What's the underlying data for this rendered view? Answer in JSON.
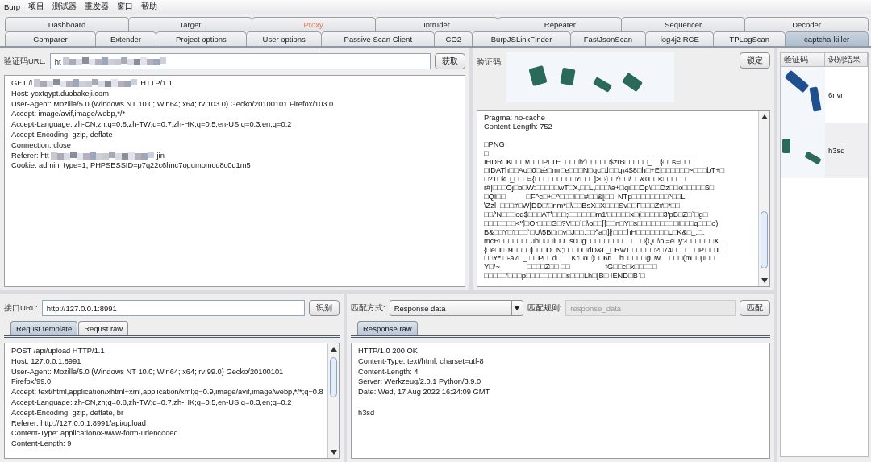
{
  "menu": [
    "Burp",
    "项目",
    "测试器",
    "重发器",
    "窗口",
    "帮助"
  ],
  "tabs_row1": [
    {
      "label": "Dashboard",
      "selected": false,
      "highlighted": false
    },
    {
      "label": "Target",
      "selected": false,
      "highlighted": false
    },
    {
      "label": "Proxy",
      "selected": false,
      "highlighted": true
    },
    {
      "label": "Intruder",
      "selected": false,
      "highlighted": false
    },
    {
      "label": "Repeater",
      "selected": false,
      "highlighted": false
    },
    {
      "label": "Sequencer",
      "selected": false,
      "highlighted": false
    },
    {
      "label": "Decoder",
      "selected": false,
      "highlighted": false
    }
  ],
  "tabs_row2": [
    {
      "label": "Comparer",
      "selected": false,
      "highlighted": false
    },
    {
      "label": "Extender",
      "selected": false,
      "highlighted": false
    },
    {
      "label": "Project options",
      "selected": false,
      "highlighted": false
    },
    {
      "label": "User options",
      "selected": false,
      "highlighted": false
    },
    {
      "label": "Passive Scan Client",
      "selected": false,
      "highlighted": false
    },
    {
      "label": "CO2",
      "selected": false,
      "highlighted": false
    },
    {
      "label": "BurpJSLinkFinder",
      "selected": false,
      "highlighted": false
    },
    {
      "label": "FastJsonScan",
      "selected": false,
      "highlighted": false
    },
    {
      "label": "log4j2 RCE",
      "selected": false,
      "highlighted": false
    },
    {
      "label": "TPLogScan",
      "selected": false,
      "highlighted": false
    },
    {
      "label": "captcha-killer",
      "selected": true,
      "highlighted": false
    }
  ],
  "captcha_request": {
    "url_label": "验证码URL:",
    "url_value": "ht",
    "fetch_button": "获取",
    "lines": [
      {
        "before": "GET /i",
        "after": "HTTP/1.1"
      },
      "Host: ycxtqypt.duobakeji.com",
      "User-Agent: Mozilla/5.0 (Windows NT 10.0; Win64; x64; rv:103.0) Gecko/20100101 Firefox/103.0",
      "Accept: image/avif,image/webp,*/*",
      "Accept-Language: zh-CN,zh;q=0.8,zh-TW;q=0.7,zh-HK;q=0.5,en-US;q=0.3,en;q=0.2",
      "Accept-Encoding: gzip, deflate",
      "Connection: close",
      {
        "before": "Referer: htt",
        "after": "jin"
      },
      "Cookie: admin_type=1; PHPSESSID=p7q22c6hnc7ogumomcu8c0q1m5"
    ]
  },
  "captcha_response": {
    "label": "验证码:",
    "lock_button": "锁定",
    "lines": [
      "Pragma: no-cache",
      "Content-Length: 752"
    ],
    "lines_after_gap": [
      "□PNG",
      "□",
      "IHDR□K□□□v□□□PLTE□□□□h^□□□□□$zrB□□□□□_□□}□□s=□□□",
      "□IDATh□□Ao□0□ǽ□mr□e□□□N□qc□⅃□□q\\4$8□h□+E|□□□□□□~□□□bT+□",
      "□?T□k□_□□□={□□□□□□□□□Y□□□]>□{□□^□□/□□&0□□<□□□□□□",
      "r#|□□□Oj□b□W:□□□□□wT□X,□□L,□□□\\a+□qi□□Op\\□□Dz□□o□□□□□6□",
      "□QI□□          □F^c□+□^□□□I□□#□□&[□□  NTp□□□□□□□□^□□L",
      "\\Zzl  □□□#□W|DD□'□nm*□\\□□BsX□X□□□Sv□□F□□□Z#□*□□",
      "□□/'N□□□oq$□□□AT\\□□□;□□□□□□m1'□□□□□x□(□□□□□3'pB□Z□`□g□",
      "□□□□□□□<\"[□Or□□□G□?V□□`□\\o□□[[□□n□Y□s□□□□□□□□□I□□□q□□□o)",
      "B&□□Y□'□□□`□U\\5B□r□v□J□□:□□^a□]∦□□□hH□□□□□□□L□K&□_:□:",
      "mcR□□□□□□□Jh□U□i□U□s0□g□□□□□□□□□□□□□{Q□\\n'=e□y?□□□□□□X□",
      "{□e□L□9□□□□]□□□D□N;□□□D□dD&L_□RwTI□□□□□?□74□□□□□□P.□□u□",
      "□□Y*.□-a7□_.□□P□□d□     Kr□o□)□□6r□□h□□□□□g□w□□□□□(m□□µ□□",
      "Y□/~             □□□□Z□□ □□                 fG□□c□k□□□□□",
      "□□□□□'□□□p□□□□□□□□□s□□□Lh□[B□ IEND□B`□"
    ]
  },
  "results": {
    "columns": [
      "验证码",
      "识别结果"
    ],
    "rows": [
      {
        "result": "6nvn",
        "selected": false
      },
      {
        "result": "h3sd",
        "selected": true
      }
    ]
  },
  "api": {
    "url_label": "接口URL:",
    "url_value": "http://127.0.0.1:8991",
    "recognize_button": "识别",
    "tabs": [
      {
        "label": "Requst template",
        "selected": true
      },
      {
        "label": "Requst raw",
        "selected": false
      }
    ],
    "lines": [
      "POST /api/upload HTTP/1.1",
      "Host: 127.0.0.1:8991",
      "User-Agent: Mozilla/5.0 (Windows NT 10.0; Win64; x64; rv:99.0) Gecko/20100101",
      "Firefox/99.0",
      "Accept: text/html,application/xhtml+xml,application/xml;q=0.9,image/avif,image/webp,*/*;q=0.8",
      "Accept-Language: zh-CN,zh;q=0.8,zh-TW;q=0.7,zh-HK;q=0.5,en-US;q=0.3,en;q=0.2",
      "Accept-Encoding: gzip, deflate, br",
      "Referer: http://127.0.0.1:8991/api/upload",
      "Content-Type: application/x-www-form-urlencoded",
      "Content-Length: 9"
    ]
  },
  "match": {
    "mode_label": "匹配方式:",
    "mode_value": "Response data",
    "rule_label": "匹配规则:",
    "rule_placeholder": "response_data",
    "match_button": "匹配",
    "tabs": [
      {
        "label": "Response raw",
        "selected": true
      }
    ],
    "lines": [
      "HTTP/1.0 200 OK",
      "Content-Type: text/html; charset=utf-8",
      "Content-Length: 4",
      "Server: Werkzeug/2.0.1 Python/3.9.0",
      "Date: Wed, 17 Aug 2022 16:24:09 GMT"
    ],
    "lines_after_gap": [
      "h3sd"
    ]
  }
}
